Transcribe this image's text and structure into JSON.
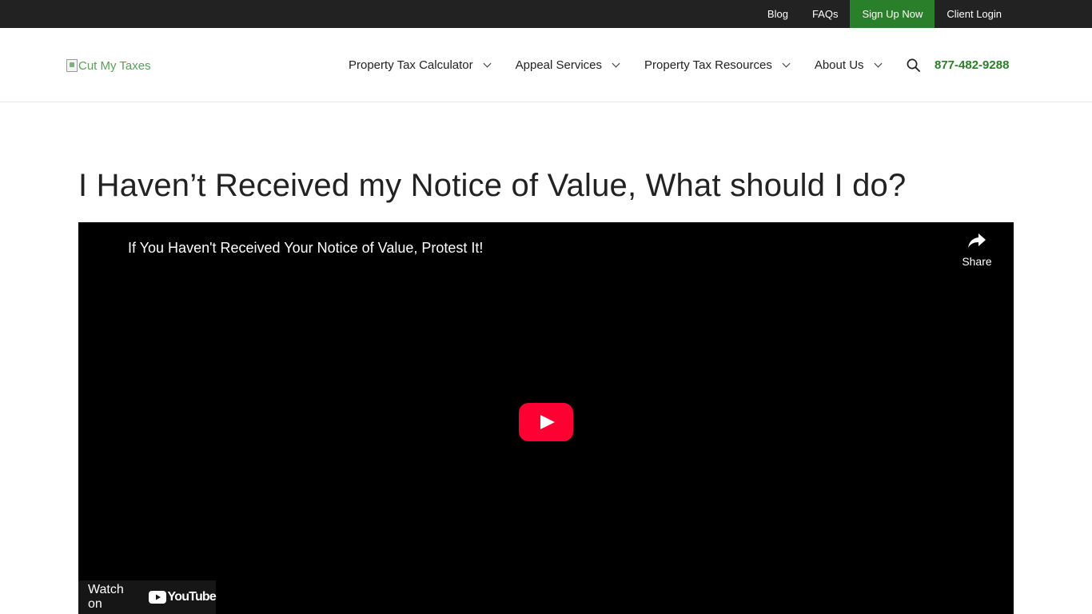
{
  "topbar": {
    "links": [
      {
        "label": "Blog"
      },
      {
        "label": "FAQs"
      },
      {
        "label": "Sign Up Now"
      },
      {
        "label": "Client Login"
      }
    ],
    "cta_color": "#2a7f2a"
  },
  "header": {
    "logo_alt": "Cut My Taxes",
    "nav": [
      {
        "label": "Property Tax Calculator",
        "icon": "chevron-down-icon"
      },
      {
        "label": "Appeal Services",
        "icon": "chevron-down-icon"
      },
      {
        "label": "Property Tax Resources",
        "icon": "chevron-down-icon"
      },
      {
        "label": "About Us",
        "icon": "chevron-down-icon"
      }
    ],
    "search_icon": "search-icon",
    "phone": "877-482-9288",
    "accent": "#2a7f2a"
  },
  "page": {
    "title": "I Haven’t Received my Notice of Value, What should I do?"
  },
  "video": {
    "title": "If You Haven't Received Your Notice of Value, Protest It!",
    "share_label": "Share",
    "watch_on_label": "Watch on",
    "youtube_word": "YouTube",
    "play_color": "#ff0033"
  }
}
